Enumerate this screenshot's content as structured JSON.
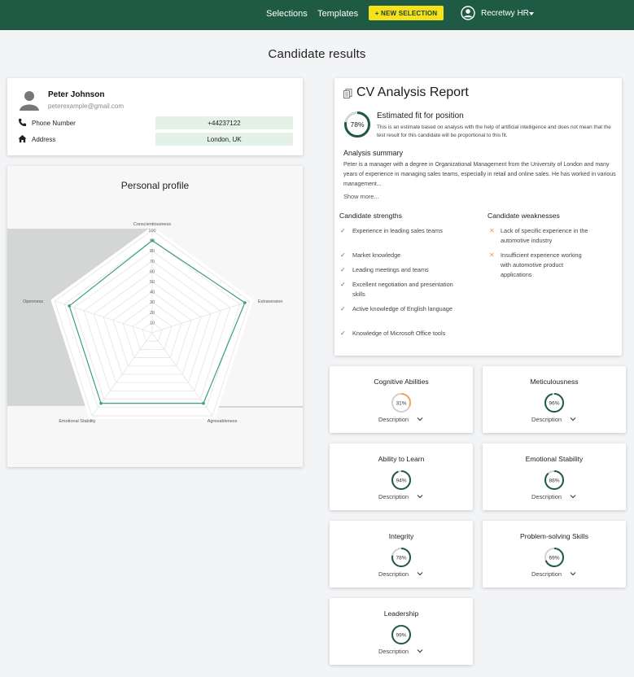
{
  "topbar": {
    "nav": [
      "Selections",
      "Templates"
    ],
    "new_selection": "+ NEW SELECTION",
    "user": "Recretwy HR",
    "brand_color": "#1e5a44",
    "accent_color": "#f6e21a"
  },
  "page_title": "Candidate results",
  "candidate": {
    "name": "Peter Johnson",
    "email": "peterexample@gmail.com",
    "phone_label": "Phone Number",
    "phone": "+44237122",
    "address_label": "Address",
    "address": "London, UK"
  },
  "personal_profile": {
    "title": "Personal profile",
    "chart_data": {
      "type": "radar",
      "axes": [
        "Conscientiousness",
        "Extraversion",
        "Agreeableness",
        "Emotional Stability",
        "Openness"
      ],
      "ticks": [
        "10",
        "20",
        "30",
        "40",
        "50",
        "60",
        "70",
        "80",
        "90",
        "100"
      ],
      "range": [
        0,
        100
      ],
      "series": [
        {
          "values": [
            90,
            95,
            85,
            85,
            85
          ],
          "color": "#3aa17a"
        }
      ],
      "grid": true
    }
  },
  "cv_report": {
    "title": "CV Analysis Report",
    "fit_value": 78,
    "fit_label": "78%",
    "fit_title": "Estimated fit for position",
    "fit_note": "This is an estimate based on analysis with the help of artificial intelligence and does not mean that the test result for this candidate will be proportional to this fit.",
    "summary_title": "Analysis summary",
    "summary_text": "Peter is a manager with a degree in Organizational Management from the University of London and many years of experience in managing sales teams, especially in retail and online sales. He has worked in various management...",
    "show_more": "Show more...",
    "strengths_title": "Candidate strengths",
    "strengths": [
      "Experience in leading sales teams",
      "Market knowledge",
      "Leading meetings and teams",
      "Excellent negotiation and presentation skills",
      "Active knowledge of English language",
      "Knowledge of Microsoft Office tools"
    ],
    "weaknesses_title": "Candidate weaknesses",
    "weaknesses": [
      "Lack of specific experience in the automotive industry",
      "Insufficient experience working with automotive product applications"
    ]
  },
  "scores": [
    {
      "title": "Cognitive Abilities",
      "value": 31,
      "label": "31%",
      "color": "#f0a65c",
      "desc": "Description"
    },
    {
      "title": "Meticulousness",
      "value": 96,
      "label": "96%",
      "color": "#1e5a44",
      "desc": "Description"
    },
    {
      "title": "Ability to Learn",
      "value": 94,
      "label": "94%",
      "color": "#1e5a44",
      "desc": "Description"
    },
    {
      "title": "Emotional Stability",
      "value": 88,
      "label": "88%",
      "color": "#1e5a44",
      "desc": "Description"
    },
    {
      "title": "Integrity",
      "value": 78,
      "label": "78%",
      "color": "#1e5a44",
      "desc": "Description"
    },
    {
      "title": "Problem-solving Skills",
      "value": 69,
      "label": "69%",
      "color": "#1e5a44",
      "desc": "Description"
    },
    {
      "title": "Leadership",
      "value": 99,
      "label": "99%",
      "color": "#1e5a44",
      "desc": "Description"
    }
  ]
}
